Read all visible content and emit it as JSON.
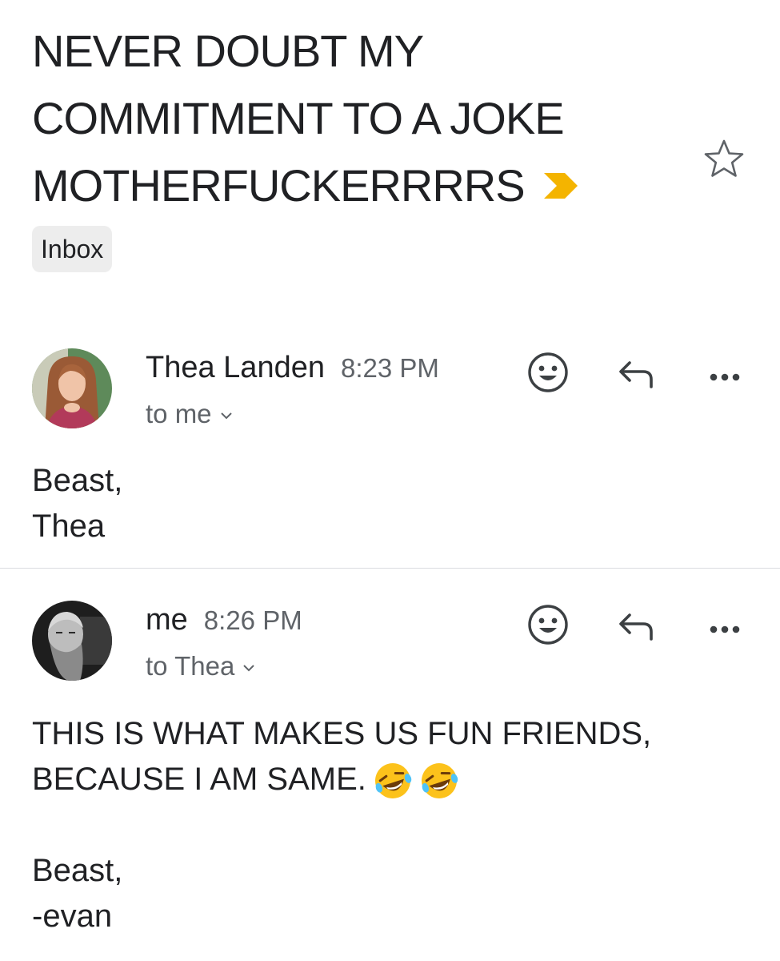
{
  "email": {
    "subject": "NEVER DOUBT MY COMMITMENT TO A JOKE MOTHERFUCKERRRRS",
    "label": "Inbox"
  },
  "icons": {
    "importance": "important-marker-icon",
    "star": "star-icon",
    "emoji_reaction": "smiley-icon",
    "reply": "reply-icon",
    "more": "more-options-icon"
  },
  "colors": {
    "importance_marker": "#f4b400",
    "secondary_text": "#5f6368"
  },
  "messages": [
    {
      "sender": "Thea Landen",
      "time": "8:23 PM",
      "recipient": "to me",
      "body_lines": [
        "Beast,",
        "Thea"
      ]
    },
    {
      "sender": "me",
      "time": "8:26 PM",
      "recipient": "to Thea",
      "body_line1": "THIS IS WHAT MAKES US FUN FRIENDS,",
      "body_line2": "BECAUSE I AM SAME.",
      "body_emojis": [
        "🤣",
        "🤣"
      ],
      "signature_lines": [
        "Beast,",
        "-evan"
      ]
    }
  ]
}
